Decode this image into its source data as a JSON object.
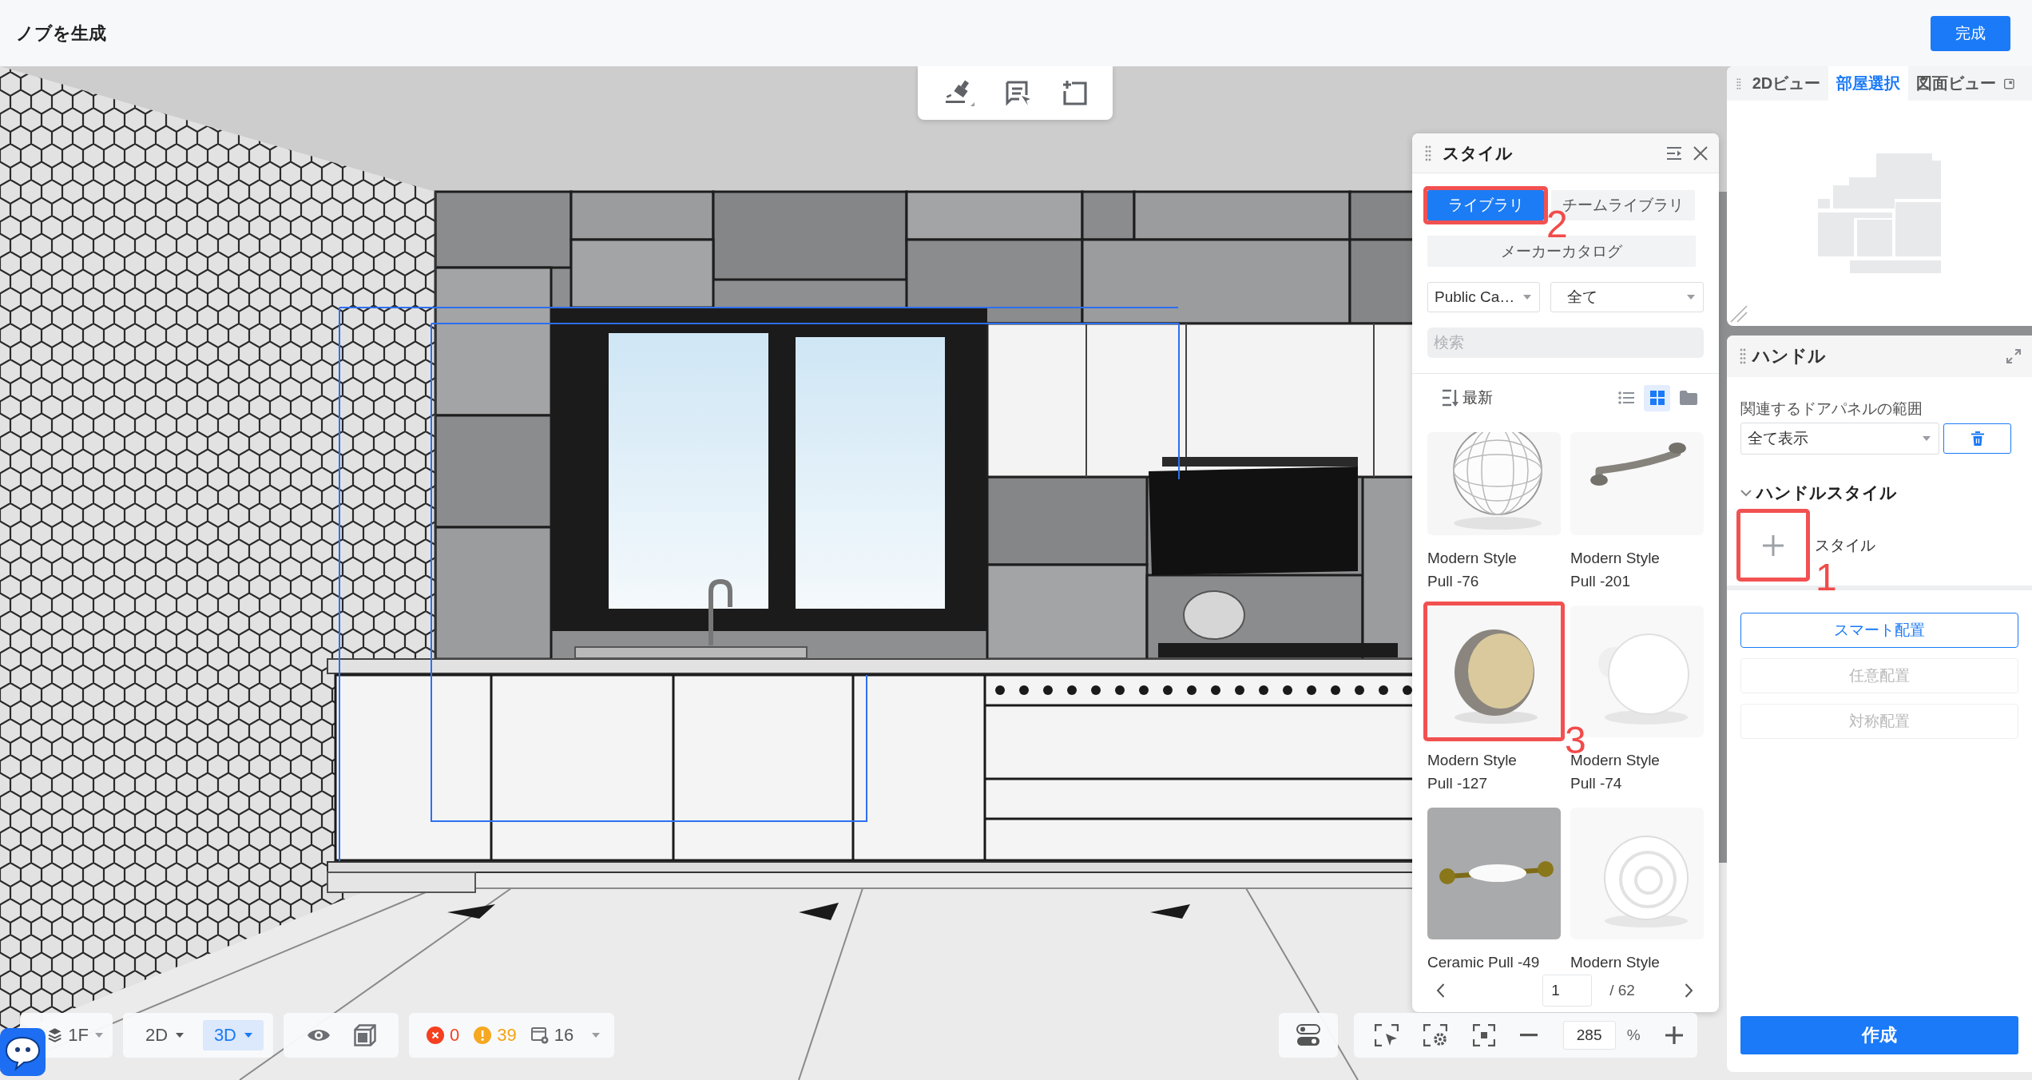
{
  "header": {
    "title": "ノブを生成",
    "done_button": "完成"
  },
  "style_panel": {
    "title": "スタイル",
    "tabs": [
      {
        "label": "ライブラリ",
        "selected": true,
        "callout": "2"
      },
      {
        "label": "チームライブラリ",
        "selected": false
      }
    ],
    "catalog_button": "メーカーカタログ",
    "filters": [
      {
        "value": "Public Ca…"
      },
      {
        "value": "全て"
      }
    ],
    "search": {
      "placeholder": "検索"
    },
    "sort": {
      "label": "最新"
    },
    "view_modes": [
      {
        "kind": "list",
        "selected": false
      },
      {
        "kind": "grid",
        "selected": true
      },
      {
        "kind": "folder",
        "selected": false
      }
    ],
    "items": [
      {
        "kind": "lattice-knob",
        "lines": [
          "Modern Style",
          "Pull -76"
        ]
      },
      {
        "kind": "bar-pull",
        "lines": [
          "Modern Style",
          "Pull -201"
        ]
      },
      {
        "kind": "stone-knob",
        "lines": [
          "Modern Style",
          "Pull -127"
        ],
        "callout": "3"
      },
      {
        "kind": "round-knob",
        "lines": [
          "Modern Style",
          "Pull -74"
        ]
      },
      {
        "kind": "ceramic-pull",
        "lines": [
          "Ceramic Pull -49"
        ]
      },
      {
        "kind": "ring-knob",
        "lines": [
          "Modern Style"
        ]
      }
    ],
    "pager": {
      "page": "1",
      "total": "/ 62"
    }
  },
  "view_panel": {
    "tabs": [
      {
        "label": "2Dビュー",
        "selected": false
      },
      {
        "label": "部屋選択",
        "selected": true
      },
      {
        "label": "図面ビュー",
        "selected": false
      }
    ]
  },
  "handle_panel": {
    "title": "ハンドル",
    "scope_label": "関連するドアパネルの範囲",
    "scope_value": "全て表示",
    "style_section": {
      "title": "ハンドルスタイル",
      "expanded": true,
      "add_callout": "1",
      "style_label": "スタイル"
    },
    "placement_buttons": [
      {
        "label": "スマート配置",
        "disabled": false
      },
      {
        "label": "任意配置",
        "disabled": true
      },
      {
        "label": "対称配置",
        "disabled": true
      }
    ],
    "create_button": "作成"
  },
  "bottom_bar": {
    "floor": "1F",
    "modes": [
      {
        "label": "2D",
        "selected": false
      },
      {
        "label": "3D",
        "selected": true
      }
    ],
    "issues": [
      {
        "kind": "error",
        "count": "0"
      },
      {
        "kind": "warning",
        "count": "39"
      },
      {
        "kind": "items",
        "count": "16"
      }
    ],
    "zoom": {
      "value": "285",
      "unit": "%"
    }
  }
}
